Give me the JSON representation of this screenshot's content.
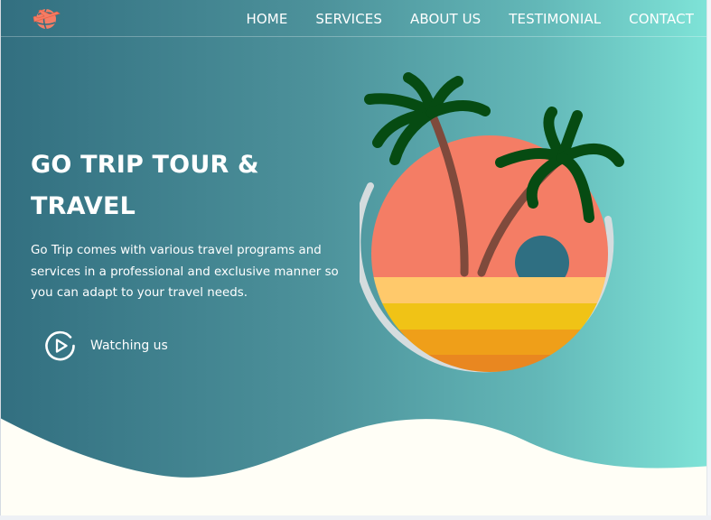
{
  "nav": {
    "logo_icon": "airplane-globe-icon",
    "links": [
      {
        "label": "HOME"
      },
      {
        "label": "SERVICES"
      },
      {
        "label": "ABOUT US"
      },
      {
        "label": "TESTIMONIAL"
      },
      {
        "label": "CONTACT"
      }
    ]
  },
  "hero": {
    "title": "GO TRIP TOUR & TRAVEL",
    "description": "Go Trip comes with various travel programs and services in a professional and exclusive manner so you can adapt to your travel needs.",
    "watch_label": "Watching us",
    "watch_icon": "play-circle-icon",
    "illustration_icon": "palm-beach-sunset-icon"
  },
  "colors": {
    "gradient_start": "#326f80",
    "gradient_end": "#7fe4d8",
    "wave_fill": "#fffef6",
    "sun": "#f47d65",
    "sand_light": "#ffc96b",
    "sand_mid": "#f0c316",
    "sand_dark": "#ef9f19",
    "palm_leaf": "#064b12",
    "palm_trunk": "#7f4a3c"
  }
}
